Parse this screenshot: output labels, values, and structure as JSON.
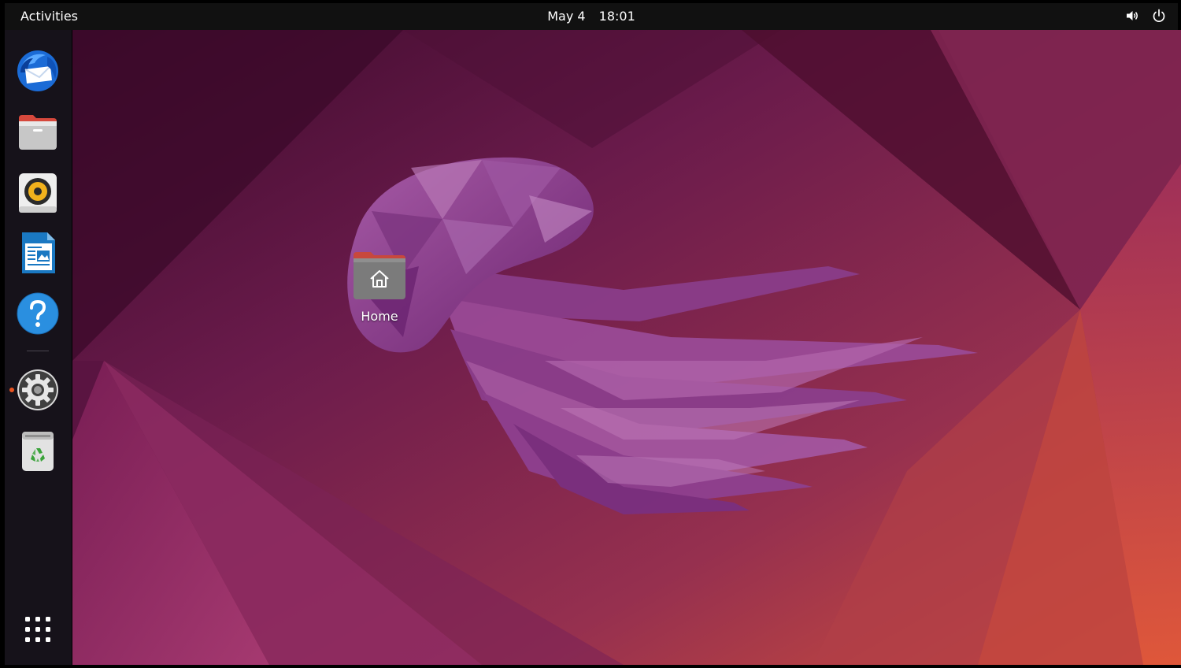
{
  "topbar": {
    "activities_label": "Activities",
    "date": "May 4",
    "time": "18:01",
    "tray_icons": [
      "volume-icon",
      "power-icon"
    ],
    "background": "#111111"
  },
  "dock": {
    "items": [
      {
        "name": "thunderbird",
        "icon": "thunderbird-icon"
      },
      {
        "name": "files",
        "icon": "files-icon"
      },
      {
        "name": "rhythmbox",
        "icon": "rhythmbox-icon"
      },
      {
        "name": "libreoffice-writer",
        "icon": "writer-icon"
      },
      {
        "name": "help",
        "icon": "help-icon"
      },
      {
        "name": "settings",
        "icon": "gear-icon",
        "running": true
      },
      {
        "name": "trash",
        "icon": "trash-icon"
      }
    ],
    "show_apps_icon": "app-grid-icon",
    "running_indicator_color": "#e95420"
  },
  "desktop": {
    "icons": [
      {
        "label": "Home",
        "icon": "home-folder-icon"
      }
    ]
  },
  "colors": {
    "wallpaper_dark": "#4a0f35",
    "wallpaper_mid": "#7a2050",
    "wallpaper_orange": "#d64a35",
    "jellyfish": "#8e3b8a"
  }
}
